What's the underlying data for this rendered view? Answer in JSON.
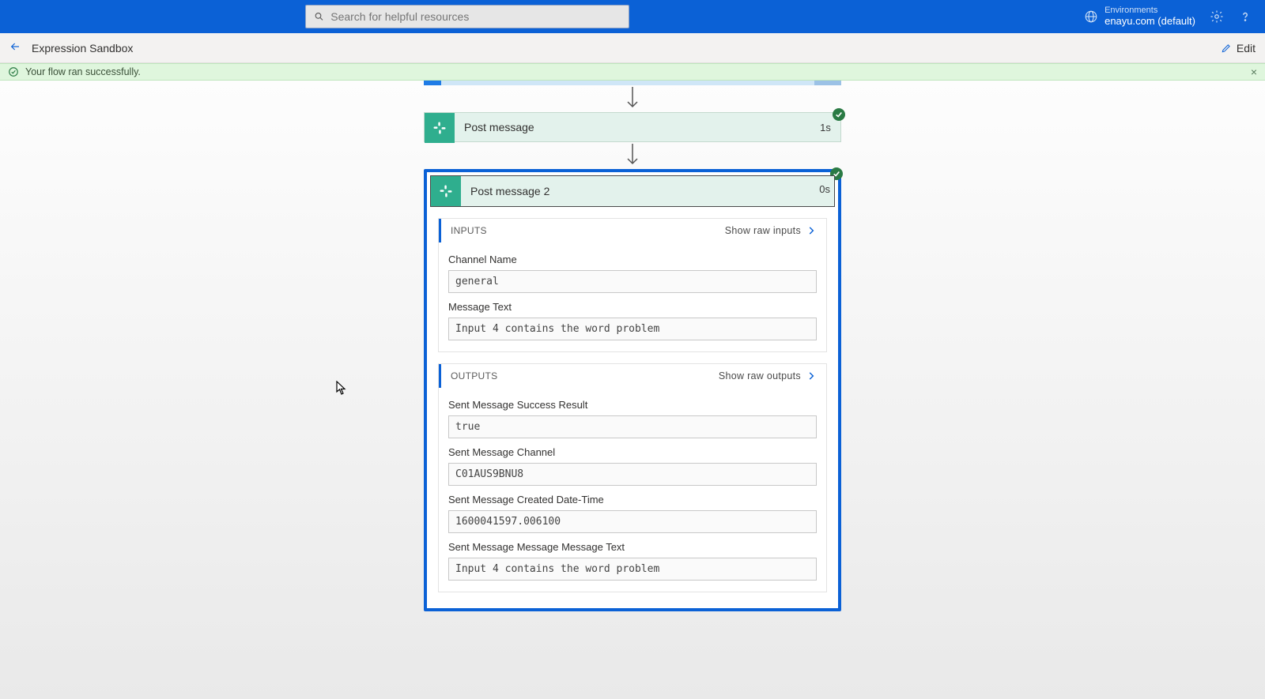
{
  "header": {
    "search_placeholder": "Search for helpful resources",
    "env_label": "Environments",
    "env_name": "enayu.com (default)"
  },
  "subheader": {
    "page_title": "Expression Sandbox",
    "edit_label": "Edit"
  },
  "banner": {
    "message": "Your flow ran successfully."
  },
  "steps": {
    "post_message": {
      "title": "Post message",
      "duration": "1s"
    },
    "post_message_2": {
      "title": "Post message 2",
      "duration": "0s"
    }
  },
  "inputs": {
    "section_label": "INPUTS",
    "raw_label": "Show raw inputs",
    "fields": {
      "channel_name_label": "Channel Name",
      "channel_name_value": "general",
      "message_text_label": "Message Text",
      "message_text_value": "Input 4 contains the word problem"
    }
  },
  "outputs": {
    "section_label": "OUTPUTS",
    "raw_label": "Show raw outputs",
    "fields": {
      "success_label": "Sent Message Success Result",
      "success_value": "true",
      "channel_label": "Sent Message Channel",
      "channel_value": "C01AUS9BNU8",
      "created_label": "Sent Message Created Date-Time",
      "created_value": "1600041597.006100",
      "text_label": "Sent Message Message Message Text",
      "text_value": "Input 4 contains the word problem"
    }
  }
}
